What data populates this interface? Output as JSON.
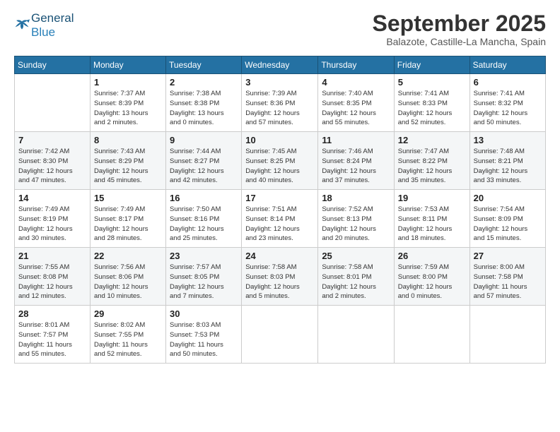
{
  "header": {
    "logo_general": "General",
    "logo_blue": "Blue",
    "month": "September 2025",
    "location": "Balazote, Castille-La Mancha, Spain"
  },
  "days_of_week": [
    "Sunday",
    "Monday",
    "Tuesday",
    "Wednesday",
    "Thursday",
    "Friday",
    "Saturday"
  ],
  "weeks": [
    [
      {
        "day": "",
        "info": ""
      },
      {
        "day": "1",
        "info": "Sunrise: 7:37 AM\nSunset: 8:39 PM\nDaylight: 13 hours\nand 2 minutes."
      },
      {
        "day": "2",
        "info": "Sunrise: 7:38 AM\nSunset: 8:38 PM\nDaylight: 13 hours\nand 0 minutes."
      },
      {
        "day": "3",
        "info": "Sunrise: 7:39 AM\nSunset: 8:36 PM\nDaylight: 12 hours\nand 57 minutes."
      },
      {
        "day": "4",
        "info": "Sunrise: 7:40 AM\nSunset: 8:35 PM\nDaylight: 12 hours\nand 55 minutes."
      },
      {
        "day": "5",
        "info": "Sunrise: 7:41 AM\nSunset: 8:33 PM\nDaylight: 12 hours\nand 52 minutes."
      },
      {
        "day": "6",
        "info": "Sunrise: 7:41 AM\nSunset: 8:32 PM\nDaylight: 12 hours\nand 50 minutes."
      }
    ],
    [
      {
        "day": "7",
        "info": "Sunrise: 7:42 AM\nSunset: 8:30 PM\nDaylight: 12 hours\nand 47 minutes."
      },
      {
        "day": "8",
        "info": "Sunrise: 7:43 AM\nSunset: 8:29 PM\nDaylight: 12 hours\nand 45 minutes."
      },
      {
        "day": "9",
        "info": "Sunrise: 7:44 AM\nSunset: 8:27 PM\nDaylight: 12 hours\nand 42 minutes."
      },
      {
        "day": "10",
        "info": "Sunrise: 7:45 AM\nSunset: 8:25 PM\nDaylight: 12 hours\nand 40 minutes."
      },
      {
        "day": "11",
        "info": "Sunrise: 7:46 AM\nSunset: 8:24 PM\nDaylight: 12 hours\nand 37 minutes."
      },
      {
        "day": "12",
        "info": "Sunrise: 7:47 AM\nSunset: 8:22 PM\nDaylight: 12 hours\nand 35 minutes."
      },
      {
        "day": "13",
        "info": "Sunrise: 7:48 AM\nSunset: 8:21 PM\nDaylight: 12 hours\nand 33 minutes."
      }
    ],
    [
      {
        "day": "14",
        "info": "Sunrise: 7:49 AM\nSunset: 8:19 PM\nDaylight: 12 hours\nand 30 minutes."
      },
      {
        "day": "15",
        "info": "Sunrise: 7:49 AM\nSunset: 8:17 PM\nDaylight: 12 hours\nand 28 minutes."
      },
      {
        "day": "16",
        "info": "Sunrise: 7:50 AM\nSunset: 8:16 PM\nDaylight: 12 hours\nand 25 minutes."
      },
      {
        "day": "17",
        "info": "Sunrise: 7:51 AM\nSunset: 8:14 PM\nDaylight: 12 hours\nand 23 minutes."
      },
      {
        "day": "18",
        "info": "Sunrise: 7:52 AM\nSunset: 8:13 PM\nDaylight: 12 hours\nand 20 minutes."
      },
      {
        "day": "19",
        "info": "Sunrise: 7:53 AM\nSunset: 8:11 PM\nDaylight: 12 hours\nand 18 minutes."
      },
      {
        "day": "20",
        "info": "Sunrise: 7:54 AM\nSunset: 8:09 PM\nDaylight: 12 hours\nand 15 minutes."
      }
    ],
    [
      {
        "day": "21",
        "info": "Sunrise: 7:55 AM\nSunset: 8:08 PM\nDaylight: 12 hours\nand 12 minutes."
      },
      {
        "day": "22",
        "info": "Sunrise: 7:56 AM\nSunset: 8:06 PM\nDaylight: 12 hours\nand 10 minutes."
      },
      {
        "day": "23",
        "info": "Sunrise: 7:57 AM\nSunset: 8:05 PM\nDaylight: 12 hours\nand 7 minutes."
      },
      {
        "day": "24",
        "info": "Sunrise: 7:58 AM\nSunset: 8:03 PM\nDaylight: 12 hours\nand 5 minutes."
      },
      {
        "day": "25",
        "info": "Sunrise: 7:58 AM\nSunset: 8:01 PM\nDaylight: 12 hours\nand 2 minutes."
      },
      {
        "day": "26",
        "info": "Sunrise: 7:59 AM\nSunset: 8:00 PM\nDaylight: 12 hours\nand 0 minutes."
      },
      {
        "day": "27",
        "info": "Sunrise: 8:00 AM\nSunset: 7:58 PM\nDaylight: 11 hours\nand 57 minutes."
      }
    ],
    [
      {
        "day": "28",
        "info": "Sunrise: 8:01 AM\nSunset: 7:57 PM\nDaylight: 11 hours\nand 55 minutes."
      },
      {
        "day": "29",
        "info": "Sunrise: 8:02 AM\nSunset: 7:55 PM\nDaylight: 11 hours\nand 52 minutes."
      },
      {
        "day": "30",
        "info": "Sunrise: 8:03 AM\nSunset: 7:53 PM\nDaylight: 11 hours\nand 50 minutes."
      },
      {
        "day": "",
        "info": ""
      },
      {
        "day": "",
        "info": ""
      },
      {
        "day": "",
        "info": ""
      },
      {
        "day": "",
        "info": ""
      }
    ]
  ]
}
